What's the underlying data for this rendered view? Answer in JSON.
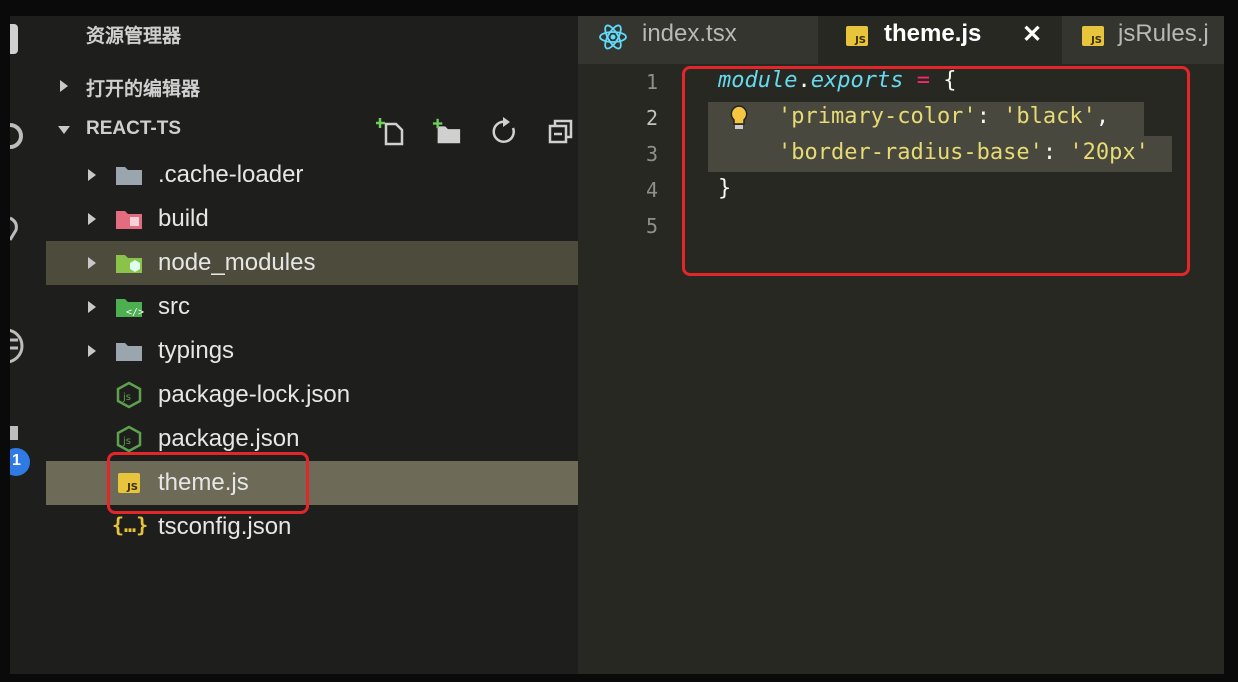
{
  "sidebar": {
    "title": "资源管理器",
    "open_editors_label": "打开的编辑器",
    "project_label": "REACT-TS",
    "tree": [
      {
        "name": ".cache-loader",
        "kind": "folder",
        "icon": "folder-icon"
      },
      {
        "name": "build",
        "kind": "folder",
        "icon": "build-folder-icon"
      },
      {
        "name": "node_modules",
        "kind": "folder",
        "icon": "node-folder-icon"
      },
      {
        "name": "src",
        "kind": "folder",
        "icon": "src-folder-icon"
      },
      {
        "name": "typings",
        "kind": "folder",
        "icon": "folder-icon"
      },
      {
        "name": "package-lock.json",
        "kind": "file",
        "icon": "nodejs-icon"
      },
      {
        "name": "package.json",
        "kind": "file",
        "icon": "nodejs-icon"
      },
      {
        "name": "theme.js",
        "kind": "file",
        "icon": "js-icon"
      },
      {
        "name": "tsconfig.json",
        "kind": "file",
        "icon": "json-braces-icon"
      }
    ]
  },
  "activity_badge": "1",
  "tabs": [
    {
      "label": "index.tsx",
      "icon": "react-icon",
      "active": false
    },
    {
      "label": "theme.js",
      "icon": "js-icon",
      "active": true
    },
    {
      "label": "jsRules.j",
      "icon": "js-icon",
      "active": false
    }
  ],
  "editor": {
    "line_numbers": [
      "1",
      "2",
      "3",
      "4",
      "5"
    ],
    "code": {
      "l1_kw1": "module",
      "l1_dot": ".",
      "l1_kw2": "exports",
      "l1_eq": " = ",
      "l1_brace": "{",
      "l2_key": "'primary-color'",
      "l2_colon": ": ",
      "l2_val": "'black'",
      "l2_comma": ",",
      "l3_key": "'border-radius-base'",
      "l3_colon": ": ",
      "l3_val": "'20px'",
      "l4_brace": "}"
    }
  },
  "colors": {
    "highlight_box": "#e3262a",
    "selected_row": "#6d6b58",
    "hover_row": "#4d4b3b",
    "editor_bg": "#272822"
  }
}
